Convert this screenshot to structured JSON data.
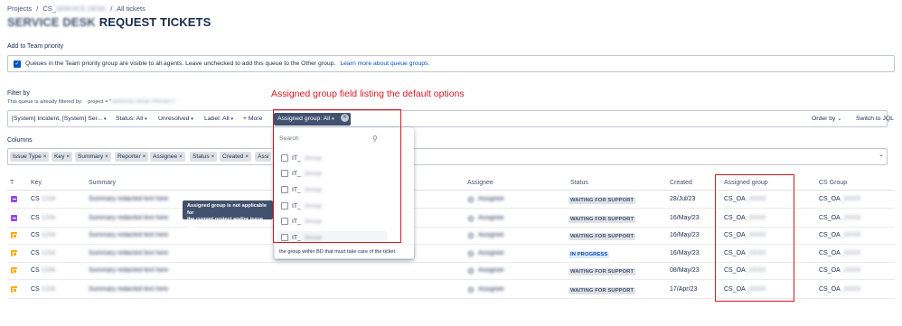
{
  "breadcrumb": {
    "projects": "Projects",
    "sep1": "/",
    "project": "CS_",
    "project_blur": "SERVICE DESK",
    "sep2": "/",
    "current": "All tickets"
  },
  "page": {
    "title_blur": "SERVICE DESK",
    "title": "REQUEST TICKETS"
  },
  "team_priority": {
    "label": "Add to Team priority",
    "text": "Queues in the Team priority group are visible to all agents. Leave unchecked to add this queue to the Other group.",
    "link": "Learn more about queue groups."
  },
  "filter": {
    "label": "Filter by",
    "already_prefix": "This queue is already filtered by:",
    "already_value": "project = \"",
    "already_blur": "SERVICE DESK PROJECT",
    "chips": [
      "[System] Incident, [System] Ser...",
      "Status: All",
      "Unresolved",
      "Label: All"
    ],
    "more": "+ More",
    "assigned_group": "Assigned group: All",
    "order_by": "Order by",
    "switch_jql": "Switch to JQL"
  },
  "columns": {
    "label": "Columns",
    "chips": [
      "Issue Type",
      "Key",
      "Summary",
      "Reporter",
      "Assignee",
      "Status",
      "Created",
      "Assi"
    ]
  },
  "table": {
    "headers": {
      "t": "T",
      "key": "Key",
      "summary": "Summary",
      "assignee": "Assignee",
      "status": "Status",
      "created": "Created",
      "assigned_group": "Assigned group",
      "cs_group": "CS Group"
    },
    "rows": [
      {
        "type": "purple",
        "key": "CS",
        "status": "WAITING FOR SUPPORT",
        "status_kind": "wait",
        "created": "28/Jul/23",
        "group": "CS_OA",
        "cs_group": "CS_OA"
      },
      {
        "type": "purple",
        "key": "CS",
        "status": "WAITING FOR SUPPORT",
        "status_kind": "wait",
        "created": "16/May/23",
        "group": "CS_OA",
        "cs_group": "CS_OA"
      },
      {
        "type": "orange",
        "key": "CS",
        "status": "WAITING FOR SUPPORT",
        "status_kind": "wait",
        "created": "16/May/23",
        "group": "CS_OA",
        "cs_group": "CS_OA"
      },
      {
        "type": "orange",
        "key": "CS",
        "status": "IN PROGRESS",
        "status_kind": "prog",
        "created": "16/May/23",
        "group": "CS_OA",
        "cs_group": "CS_OA"
      },
      {
        "type": "orange",
        "key": "CS",
        "status": "WAITING FOR SUPPORT",
        "status_kind": "wait",
        "created": "08/May/23",
        "group": "CS_OA",
        "cs_group": "CS_OA"
      },
      {
        "type": "orange",
        "key": "CS",
        "status": "WAITING FOR SUPPORT",
        "status_kind": "wait",
        "created": "17/Apr/23",
        "group": "CS_OA",
        "cs_group": "CS_OA"
      }
    ]
  },
  "dropdown": {
    "search_placeholder": "Search",
    "options": [
      "IT_",
      "IT_",
      "IT_",
      "IT_",
      "IT_",
      "IT_"
    ],
    "hint": "the group within BD that must take care of the ticket."
  },
  "tooltip": {
    "line1": "Assigned group is not applicable for",
    "line2": "the current project and/or issue type"
  },
  "annotation": {
    "text": "Assigned group field listing the default options",
    "color": "#d71920"
  }
}
